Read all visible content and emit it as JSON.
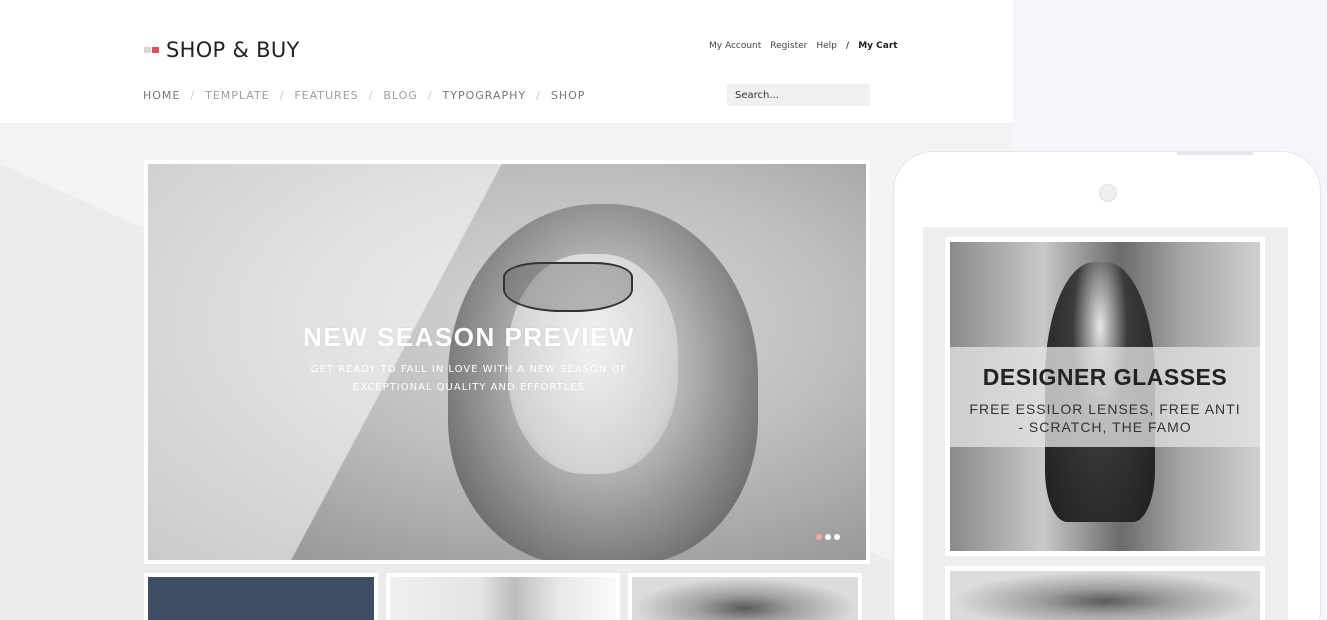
{
  "header": {
    "logo_text": "SHOP & BUY",
    "account_links": [
      "My Account",
      "Register",
      "Help"
    ],
    "separator": "/",
    "cart_label": "My Cart"
  },
  "nav": {
    "items": [
      "HOME",
      "TEMPLATE",
      "FEATURES",
      "BLOG",
      "TYPOGRAPHY",
      "SHOP"
    ],
    "separator": "/"
  },
  "search": {
    "placeholder": "Search..."
  },
  "slider": {
    "title": "NEW SEASON PREVIEW",
    "subtitle_line1": "GET READY TO FALL IN LOVE WITH A NEW SEASON OF",
    "subtitle_line2": "EXCEPTIONAL QUALITY AND EFFORTLES",
    "slide_count": 3,
    "active_slide": 1
  },
  "mobile_preview": {
    "title": "DESIGNER GLASSES",
    "subtitle": "FREE ESSILOR LENSES, FREE ANTI - SCRATCH, THE FAMO"
  },
  "colors": {
    "accent": "#e0505a",
    "thumb_navy": "#3e4d63",
    "dot_active": "#f0a9a9"
  }
}
